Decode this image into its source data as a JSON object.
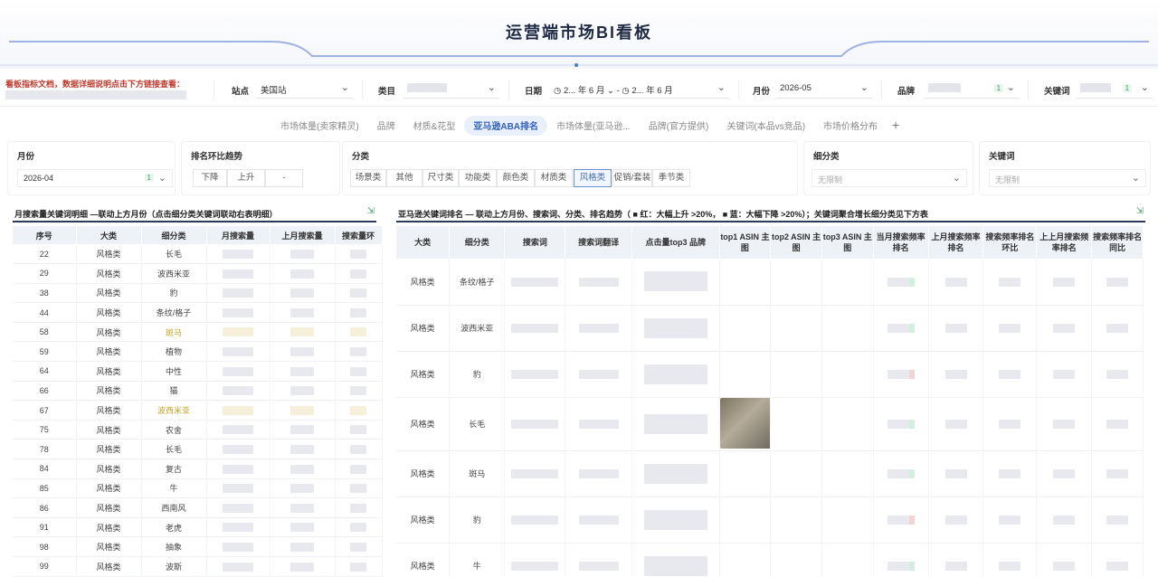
{
  "header": {
    "title": "运营端市场BI看板"
  },
  "filters": {
    "notice": "看板指标文档，数据详细说明点击下方链接查看：",
    "site": {
      "label": "站点",
      "value": "美国站"
    },
    "category": {
      "label": "类目"
    },
    "date": {
      "label": "日期",
      "start": "2... 年 6 月",
      "end": "2... 年 6 月"
    },
    "month": {
      "label": "月份",
      "value": "2026-05"
    },
    "brand": {
      "label": "品牌",
      "count": "1"
    },
    "keyword": {
      "label": "关键词",
      "count": "1"
    }
  },
  "tabs": [
    {
      "label": "市场体量(卖家精灵)"
    },
    {
      "label": "品牌"
    },
    {
      "label": "材质&花型"
    },
    {
      "label": "亚马逊ABA排名"
    },
    {
      "label": "市场体量(亚马逊..."
    },
    {
      "label": "品牌(官方提供)"
    },
    {
      "label": "关键词(本品vs竞品)"
    },
    {
      "label": "市场价格分布"
    }
  ],
  "tab_add": "+",
  "subfilters": {
    "month": {
      "label": "月份",
      "value": "2026-04",
      "count": "1"
    },
    "trend": {
      "label": "排名环比趋势",
      "options": [
        "下降",
        "上升",
        "-"
      ]
    },
    "class": {
      "label": "分类",
      "options": [
        "场景类",
        "其他",
        "尺寸类",
        "功能类",
        "颜色类",
        "材质类",
        "风格类",
        "促销/套装",
        "季节类"
      ],
      "active": "风格类"
    },
    "subclass": {
      "label": "细分类",
      "placeholder": "无限制"
    },
    "keyword": {
      "label": "关键词",
      "placeholder": "无限制"
    }
  },
  "left_table": {
    "title": "月搜索量关键词明细 —联动上方月份（点击细分类关键词联动右表明细）",
    "columns": [
      "序号",
      "大类",
      "细分类",
      "月搜索量",
      "上月搜索量",
      "搜索量环"
    ],
    "rows": [
      {
        "no": "22",
        "cat": "风格类",
        "sub": "长毛",
        "hl": false
      },
      {
        "no": "29",
        "cat": "风格类",
        "sub": "波西米亚",
        "hl": false
      },
      {
        "no": "38",
        "cat": "风格类",
        "sub": "豹",
        "hl": false
      },
      {
        "no": "44",
        "cat": "风格类",
        "sub": "条纹/格子",
        "hl": false
      },
      {
        "no": "58",
        "cat": "风格类",
        "sub": "斑马",
        "hl": true
      },
      {
        "no": "59",
        "cat": "风格类",
        "sub": "植物",
        "hl": false
      },
      {
        "no": "64",
        "cat": "风格类",
        "sub": "中性",
        "hl": false
      },
      {
        "no": "66",
        "cat": "风格类",
        "sub": "猫",
        "hl": false
      },
      {
        "no": "67",
        "cat": "风格类",
        "sub": "波西米亚",
        "hl": true
      },
      {
        "no": "75",
        "cat": "风格类",
        "sub": "农舍",
        "hl": false
      },
      {
        "no": "78",
        "cat": "风格类",
        "sub": "长毛",
        "hl": false
      },
      {
        "no": "84",
        "cat": "风格类",
        "sub": "复古",
        "hl": false
      },
      {
        "no": "85",
        "cat": "风格类",
        "sub": "牛",
        "hl": false
      },
      {
        "no": "86",
        "cat": "风格类",
        "sub": "西南风",
        "hl": false
      },
      {
        "no": "91",
        "cat": "风格类",
        "sub": "老虎",
        "hl": false
      },
      {
        "no": "98",
        "cat": "风格类",
        "sub": "抽象",
        "hl": false
      },
      {
        "no": "99",
        "cat": "风格类",
        "sub": "波斯",
        "hl": false
      }
    ]
  },
  "right_table": {
    "title": "亚马逊关键词排名 — 联动上方月份、搜索词、分类、排名趋势（ ■ 红：大幅上升 >20%， ■ 蓝：大幅下降 >20%）；关键词聚合增长细分类见下方表",
    "columns": [
      "大类",
      "细分类",
      "搜索词",
      "搜索词翻译",
      "点击量top3 品牌",
      "top1 ASIN 主图",
      "top2 ASIN 主图",
      "top3 ASIN 主图",
      "当月搜索频率排名",
      "上月搜索频率排名",
      "搜索频率排名环比",
      "上上月搜索频率排名",
      "搜索频率排名同比"
    ],
    "rows": [
      {
        "cat": "风格类",
        "sub": "条纹/格子"
      },
      {
        "cat": "风格类",
        "sub": "波西米亚"
      },
      {
        "cat": "风格类",
        "sub": "豹"
      },
      {
        "cat": "风格类",
        "sub": "长毛"
      },
      {
        "cat": "风格类",
        "sub": "斑马"
      },
      {
        "cat": "风格类",
        "sub": "豹"
      },
      {
        "cat": "风格类",
        "sub": "牛"
      }
    ]
  }
}
